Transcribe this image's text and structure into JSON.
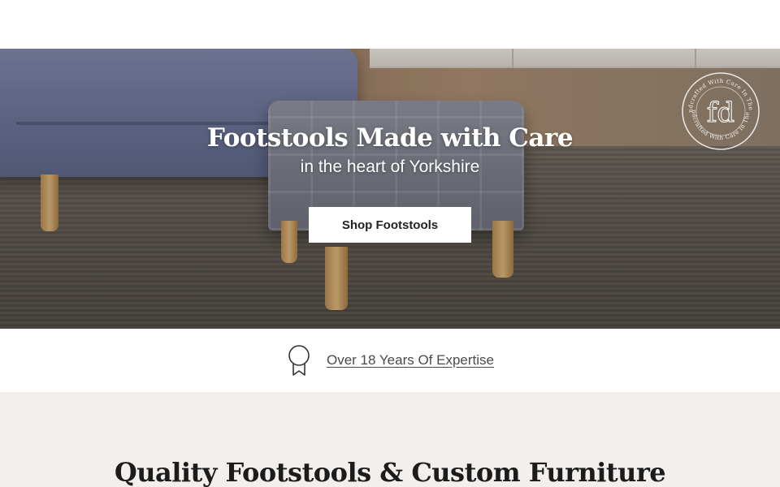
{
  "hero": {
    "title": "Footstools Made with Care",
    "subtitle": "in the heart of Yorkshire",
    "cta_label": "Shop Footstools",
    "badge_text": "Handcrafted With Care In The Uk",
    "badge_monogram": "fd"
  },
  "expertise": {
    "icon": "award-ribbon-icon",
    "link_label": "Over 18 Years Of Expertise"
  },
  "section": {
    "heading": "Quality Footstools & Custom Furniture"
  },
  "colors": {
    "background": "#ffffff",
    "section_bg": "#f2efec",
    "text_dark": "#1c1c1c",
    "link_text": "#4a4a4a"
  }
}
